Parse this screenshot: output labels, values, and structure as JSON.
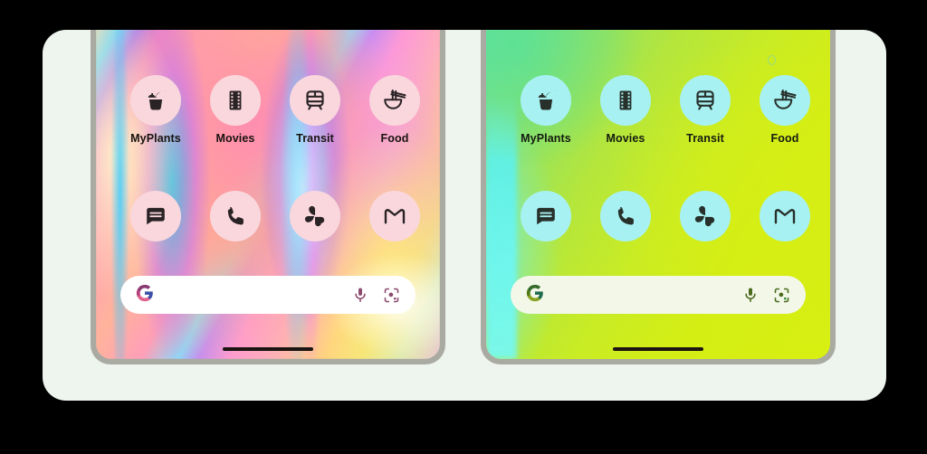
{
  "scene": {
    "description": "Two Android phone home screens side by side showing Material You dynamic color theming",
    "card_background": "#eef4ee",
    "page_background": "#000000",
    "bezel_color": "#a9aaa2"
  },
  "phones": [
    {
      "id": "phone-pink",
      "name": "Phone with iridescent bubble wallpaper",
      "theme": {
        "icon_circle": "#f9d7dd",
        "icon_glyph": "#2a2326",
        "search_bar_bg": "#ffffff",
        "search_icon_color": "#8c4b6e",
        "label_color": "#18120f",
        "accent": "#f9d7dd"
      },
      "wallpaper": {
        "name": "iridescent-bubble",
        "colors": [
          "#f4ddb2",
          "#7fd6f2",
          "#a77ef0",
          "#f07fd0",
          "#ffa0b6",
          "#ffb39c",
          "#ffd27f",
          "#f2e07a",
          "#c8e8e0"
        ]
      },
      "has_camera_cutout": false,
      "apps": [
        {
          "label": "MyPlants",
          "icon": "potted-plant-icon"
        },
        {
          "label": "Movies",
          "icon": "film-strip-icon"
        },
        {
          "label": "Transit",
          "icon": "train-icon"
        },
        {
          "label": "Food",
          "icon": "noodle-bowl-icon"
        },
        {
          "label": "",
          "icon": "messages-icon"
        },
        {
          "label": "",
          "icon": "phone-icon"
        },
        {
          "label": "",
          "icon": "photos-pinwheel-icon"
        },
        {
          "label": "",
          "icon": "gmail-icon"
        }
      ],
      "search": {
        "placeholder": "",
        "value": "",
        "logo": "google-g-icon",
        "mic": "microphone-icon",
        "lens": "google-lens-icon"
      },
      "home_indicator": true
    },
    {
      "id": "phone-lime",
      "name": "Phone with lime green gradient wallpaper",
      "theme": {
        "icon_circle": "#a8f1f2",
        "icon_glyph": "#27302b",
        "search_bar_bg": "#f2f7e8",
        "search_icon_color": "#4a6b1e",
        "label_color": "#141a10",
        "accent": "#a8f1f2"
      },
      "wallpaper": {
        "name": "lime-gradient",
        "colors": [
          "#66e2a5",
          "#8fe165",
          "#b4e63c",
          "#c9ec24",
          "#d8ef10",
          "#6ef5e6"
        ]
      },
      "has_camera_cutout": true,
      "apps": [
        {
          "label": "MyPlants",
          "icon": "potted-plant-icon"
        },
        {
          "label": "Movies",
          "icon": "film-strip-icon"
        },
        {
          "label": "Transit",
          "icon": "train-icon"
        },
        {
          "label": "Food",
          "icon": "noodle-bowl-icon"
        },
        {
          "label": "",
          "icon": "messages-icon"
        },
        {
          "label": "",
          "icon": "phone-icon"
        },
        {
          "label": "",
          "icon": "photos-pinwheel-icon"
        },
        {
          "label": "",
          "icon": "gmail-icon"
        }
      ],
      "search": {
        "placeholder": "",
        "value": "",
        "logo": "google-g-icon",
        "mic": "microphone-icon",
        "lens": "google-lens-icon"
      },
      "home_indicator": true
    }
  ]
}
